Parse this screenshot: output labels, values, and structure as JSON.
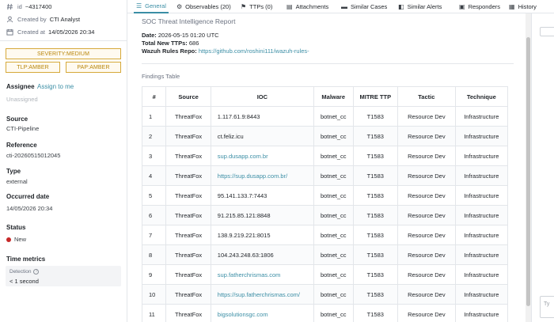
{
  "sidebar": {
    "id_label": "id",
    "id_value": "~4317400",
    "created_by_label": "Created by",
    "created_by_value": "CTI Analyst",
    "created_at_label": "Created at",
    "created_at_value": "14/05/2026 20:34",
    "severity_pill": "SEVERITY:MEDIUM",
    "tlp_pill": "TLP:AMBER",
    "pap_pill": "PAP:AMBER",
    "assignee_label": "Assignee",
    "assign_link": "Assign to me",
    "assignee_value": "Unassigned",
    "source_label": "Source",
    "source_value": "CTI-Pipeline",
    "reference_label": "Reference",
    "reference_value": "cti-20260515012045",
    "type_label": "Type",
    "type_value": "external",
    "occurred_label": "Occurred date",
    "occurred_value": "14/05/2026 20:34",
    "status_label": "Status",
    "status_value": "New",
    "status_color": "#c62828",
    "time_metrics_label": "Time metrics",
    "detection_label": "Detection",
    "detection_value": "< 1 second"
  },
  "tabs": [
    {
      "label": "General",
      "icon": "sliders-icon",
      "active": true
    },
    {
      "label": "Observables (20)",
      "icon": "settings-icon",
      "active": false
    },
    {
      "label": "TTPs (0)",
      "icon": "flag-icon",
      "active": false
    },
    {
      "label": "Attachments",
      "icon": "file-icon",
      "active": false
    },
    {
      "label": "Similar Cases",
      "icon": "briefcase-icon",
      "active": false
    },
    {
      "label": "Similar Alerts",
      "icon": "alerts-icon",
      "active": false
    },
    {
      "label": "Responders",
      "icon": "responders-icon",
      "active": false
    },
    {
      "label": "History",
      "icon": "history-icon",
      "active": false
    }
  ],
  "report": {
    "title": "SOC Threat Intelligence Report",
    "date_label": "Date:",
    "date_value": "2026-05-15 01:20 UTC",
    "ttps_label": "Total New TTPs:",
    "ttps_value": "686",
    "repo_label": "Wazuh Rules Repo:",
    "repo_value": "https://github.com/roshini111/wazuh-rules-",
    "findings_title": "Findings Table"
  },
  "table": {
    "headers": [
      "#",
      "Source",
      "IOC",
      "Malware",
      "MITRE TTP",
      "Tactic",
      "Technique"
    ],
    "rows": [
      {
        "n": "1",
        "source": "ThreatFox",
        "ioc": "1.117.61.9:8443",
        "link": false,
        "malware": "botnet_cc",
        "ttp": "T1583",
        "tactic": "Resource Dev",
        "technique": "Infrastructure"
      },
      {
        "n": "2",
        "source": "ThreatFox",
        "ioc": "ct.feliz.icu",
        "link": false,
        "malware": "botnet_cc",
        "ttp": "T1583",
        "tactic": "Resource Dev",
        "technique": "Infrastructure"
      },
      {
        "n": "3",
        "source": "ThreatFox",
        "ioc": "sup.dusapp.com.br",
        "link": true,
        "malware": "botnet_cc",
        "ttp": "T1583",
        "tactic": "Resource Dev",
        "technique": "Infrastructure"
      },
      {
        "n": "4",
        "source": "ThreatFox",
        "ioc": "https://sup.dusapp.com.br/",
        "link": true,
        "malware": "botnet_cc",
        "ttp": "T1583",
        "tactic": "Resource Dev",
        "technique": "Infrastructure"
      },
      {
        "n": "5",
        "source": "ThreatFox",
        "ioc": "95.141.133.7:7443",
        "link": false,
        "malware": "botnet_cc",
        "ttp": "T1583",
        "tactic": "Resource Dev",
        "technique": "Infrastructure"
      },
      {
        "n": "6",
        "source": "ThreatFox",
        "ioc": "91.215.85.121:8848",
        "link": false,
        "malware": "botnet_cc",
        "ttp": "T1583",
        "tactic": "Resource Dev",
        "technique": "Infrastructure"
      },
      {
        "n": "7",
        "source": "ThreatFox",
        "ioc": "138.9.219.221:8015",
        "link": false,
        "malware": "botnet_cc",
        "ttp": "T1583",
        "tactic": "Resource Dev",
        "technique": "Infrastructure"
      },
      {
        "n": "8",
        "source": "ThreatFox",
        "ioc": "104.243.248.63:1806",
        "link": false,
        "malware": "botnet_cc",
        "ttp": "T1583",
        "tactic": "Resource Dev",
        "technique": "Infrastructure"
      },
      {
        "n": "9",
        "source": "ThreatFox",
        "ioc": "sup.fatherchrismas.com",
        "link": true,
        "malware": "botnet_cc",
        "ttp": "T1583",
        "tactic": "Resource Dev",
        "technique": "Infrastructure"
      },
      {
        "n": "10",
        "source": "ThreatFox",
        "ioc": "https://sup.fatherchrismas.com/",
        "link": true,
        "malware": "botnet_cc",
        "ttp": "T1583",
        "tactic": "Resource Dev",
        "technique": "Infrastructure"
      },
      {
        "n": "11",
        "source": "ThreatFox",
        "ioc": "bigsolutionsgc.com",
        "link": true,
        "malware": "botnet_cc",
        "ttp": "T1583",
        "tactic": "Resource Dev",
        "technique": "Infrastructure"
      }
    ]
  },
  "right_panel": {
    "input_placeholder": "Ty"
  }
}
